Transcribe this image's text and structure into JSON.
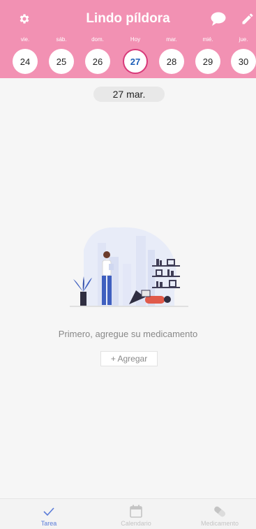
{
  "header": {
    "title": "Lindo píldora",
    "color": "#f291b3"
  },
  "days": [
    {
      "label": "vie.",
      "day": "24"
    },
    {
      "label": "sáb.",
      "day": "25"
    },
    {
      "label": "dom.",
      "day": "26"
    },
    {
      "label": "Hoy",
      "day": "27"
    },
    {
      "label": "mar.",
      "day": "28"
    },
    {
      "label": "mié.",
      "day": "29"
    },
    {
      "label": "jue.",
      "day": "30"
    }
  ],
  "selected_date": "27 mar.",
  "empty_state": {
    "message": "Primero, agregue su medicamento",
    "add_label": "+ Agregar"
  },
  "nav": {
    "tarea": "Tarea",
    "calendario": "Calendario",
    "medicamento": "Medicamento"
  }
}
